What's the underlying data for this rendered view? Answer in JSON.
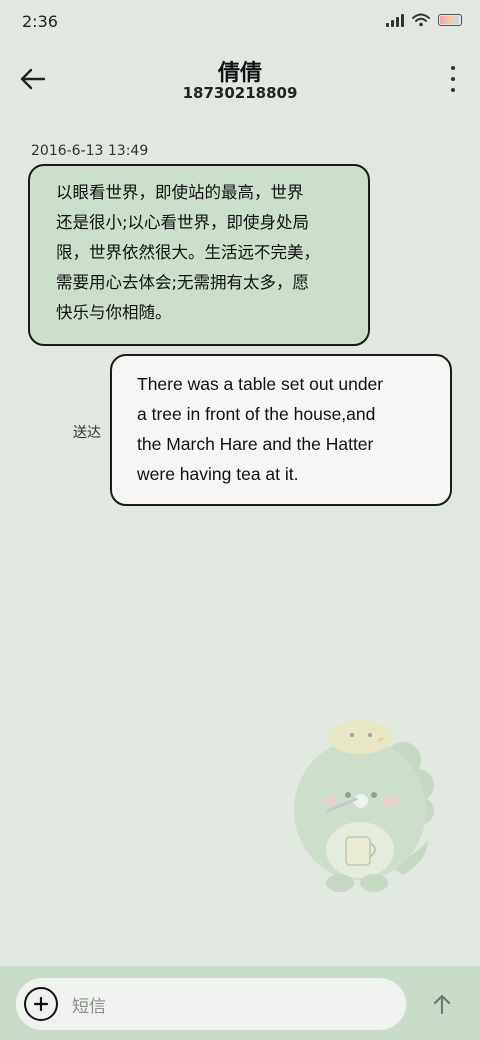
{
  "status_bar": {
    "time": "2:36",
    "icons": [
      "signal-icon",
      "wifi-icon",
      "battery-icon"
    ]
  },
  "header": {
    "contact_name": "倩倩",
    "contact_number": "18730218809",
    "back_icon": "arrow-left-icon",
    "more_icon": "more-vertical-icon"
  },
  "messages": [
    {
      "direction": "incoming",
      "timestamp": "2016-6-13 13:49",
      "lines": [
        "以眼看世界，即使站的最高，世界",
        "还是很小;以心看世界，即使身处局",
        "限，世界依然很大。生活远不完美，",
        "需要用心去体会;无需拥有太多，愿",
        "快乐与你相随。"
      ]
    },
    {
      "direction": "outgoing",
      "status": "送达",
      "lines": [
        "There was a table set out under",
        "a tree in front of the house,and",
        "the March Hare and the Hatter",
        "were having tea at it."
      ]
    }
  ],
  "input_bar": {
    "placeholder": "短信",
    "add_icon": "plus-circle-icon",
    "send_icon": "arrow-up-icon"
  },
  "colors": {
    "background": "#e0e8e0",
    "incoming_bubble": "#cbdfcb",
    "outgoing_bubble": "#f6f6f5",
    "input_bar": "#c9dcc9",
    "input_field": "#eef1ee"
  }
}
